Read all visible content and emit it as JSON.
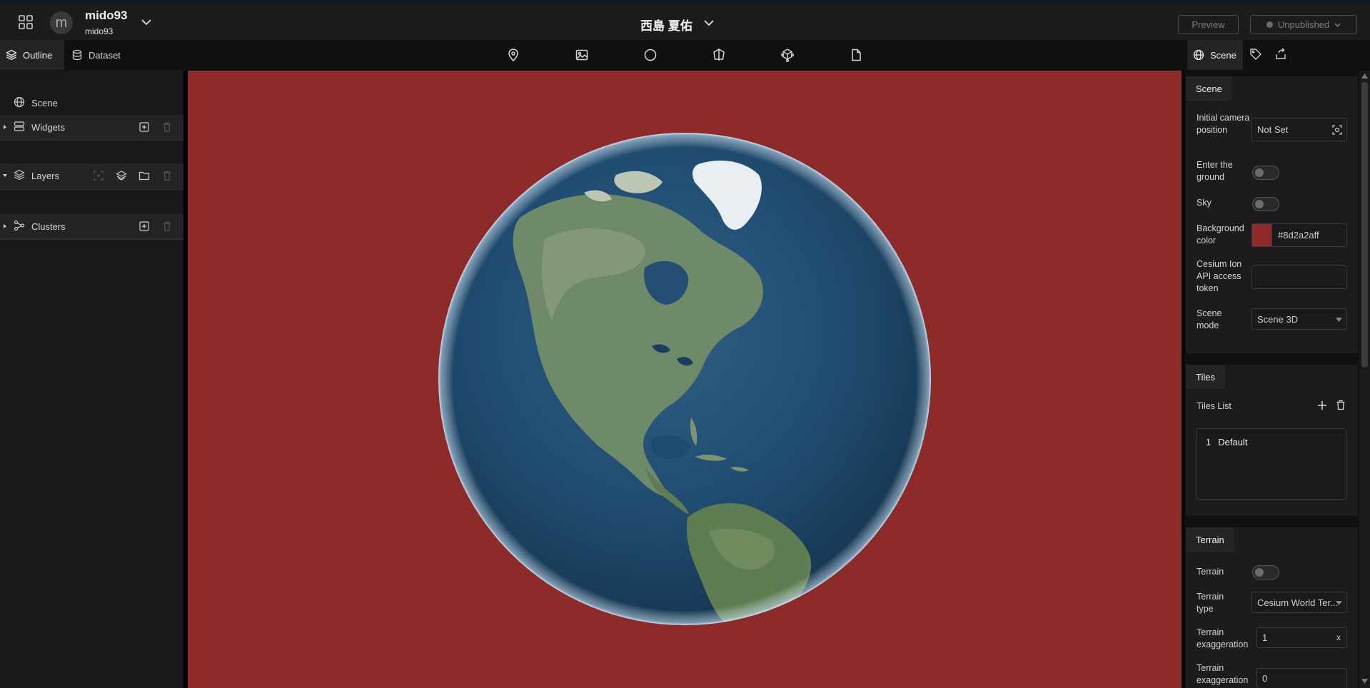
{
  "header": {
    "workspace_initial": "m",
    "workspace_name": "mido93",
    "workspace_user": "mido93",
    "project_title": "西島 夏佑",
    "preview_label": "Preview",
    "publish_label": "Unpublished"
  },
  "left_tabs": {
    "outline": "Outline",
    "dataset": "Dataset"
  },
  "tools": [
    "marker-icon",
    "image-icon",
    "circle-icon",
    "polygon-icon",
    "model-icon",
    "file-icon"
  ],
  "outline": {
    "scene": "Scene",
    "widgets": "Widgets",
    "layers": "Layers",
    "clusters": "Clusters"
  },
  "right_tabs": {
    "scene": "Scene"
  },
  "scene_section": {
    "title": "Scene",
    "camera_label": "Initial camera position",
    "camera_value": "Not Set",
    "ground_label": "Enter the ground",
    "ground_on": false,
    "sky_label": "Sky",
    "sky_on": false,
    "bg_label": "Background color",
    "bg_value": "#8d2a2aff",
    "token_label": "Cesium Ion API access token",
    "token_value": "",
    "mode_label": "Scene mode",
    "mode_value": "Scene 3D"
  },
  "tiles_section": {
    "title": "Tiles",
    "list_label": "Tiles List",
    "items": [
      {
        "index": "1",
        "name": "Default"
      }
    ]
  },
  "terrain_section": {
    "title": "Terrain",
    "terrain_label": "Terrain",
    "terrain_on": false,
    "type_label": "Terrain type",
    "type_value": "Cesium World Ter...",
    "exag_label": "Terrain exaggeration",
    "exag_value": "1",
    "exag2_label": "Terrain exaggeration",
    "exag2_value": "0"
  },
  "colors": {
    "background": "#8d2a2a",
    "panel": "#1c1c1e",
    "accent_tab": "#242426"
  }
}
